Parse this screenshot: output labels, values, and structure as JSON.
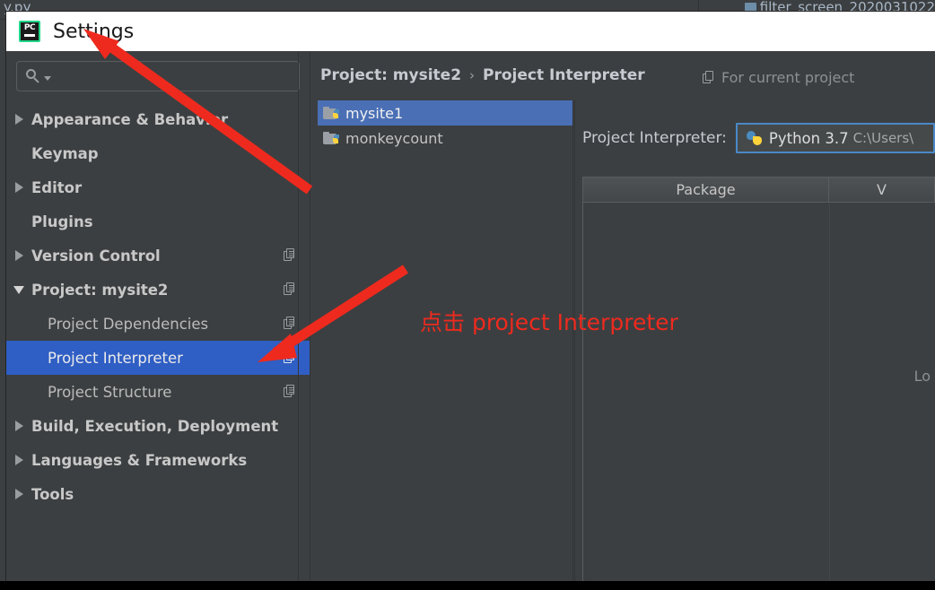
{
  "background": {
    "tab_left": "y.py",
    "tab_right": "filter_screen_2020031022",
    "tab_right_icon": "file-icon"
  },
  "dialog": {
    "title": "Settings",
    "logo_icon": "pycharm-logo-icon",
    "logo_text": "PC"
  },
  "search": {
    "value": "",
    "placeholder": "",
    "icon": "search-icon",
    "caret_icon": "chevron-down-icon"
  },
  "sidebar": {
    "items": [
      {
        "label": "Appearance & Behavior",
        "twisty": "collapsed",
        "indent": 0,
        "bold": true,
        "copy": false,
        "selected": false
      },
      {
        "label": "Keymap",
        "twisty": "none",
        "indent": 0,
        "bold": true,
        "copy": false,
        "selected": false
      },
      {
        "label": "Editor",
        "twisty": "collapsed",
        "indent": 0,
        "bold": true,
        "copy": false,
        "selected": false
      },
      {
        "label": "Plugins",
        "twisty": "none",
        "indent": 0,
        "bold": true,
        "copy": false,
        "selected": false
      },
      {
        "label": "Version Control",
        "twisty": "collapsed",
        "indent": 0,
        "bold": true,
        "copy": true,
        "selected": false
      },
      {
        "label": "Project: mysite2",
        "twisty": "expanded",
        "indent": 0,
        "bold": true,
        "copy": true,
        "selected": false
      },
      {
        "label": "Project Dependencies",
        "twisty": "none",
        "indent": 1,
        "bold": false,
        "copy": true,
        "selected": false
      },
      {
        "label": "Project Interpreter",
        "twisty": "none",
        "indent": 1,
        "bold": false,
        "copy": true,
        "selected": true
      },
      {
        "label": "Project Structure",
        "twisty": "none",
        "indent": 1,
        "bold": false,
        "copy": true,
        "selected": false
      },
      {
        "label": "Build, Execution, Deployment",
        "twisty": "collapsed",
        "indent": 0,
        "bold": true,
        "copy": false,
        "selected": false
      },
      {
        "label": "Languages & Frameworks",
        "twisty": "collapsed",
        "indent": 0,
        "bold": true,
        "copy": false,
        "selected": false
      },
      {
        "label": "Tools",
        "twisty": "collapsed",
        "indent": 0,
        "bold": true,
        "copy": false,
        "selected": false
      }
    ]
  },
  "main": {
    "breadcrumb": {
      "parent": "Project: mysite2",
      "separator": "›",
      "current": "Project Interpreter"
    },
    "for_current_project": {
      "label": "For current project",
      "icon": "copy-icon"
    },
    "projects": [
      {
        "label": "mysite1",
        "icon": "python-folder-icon",
        "selected": true
      },
      {
        "label": "monkeycount",
        "icon": "python-folder-icon",
        "selected": false
      }
    ],
    "interpreter": {
      "label": "Project Interpreter:",
      "icon": "python-icon",
      "name": "Python 3.7",
      "path": "C:\\Users\\"
    },
    "packages_table": {
      "columns": [
        "Package",
        "V"
      ],
      "rows": [],
      "status": "Lo"
    }
  },
  "annotations": {
    "accent_color": "#ee2a1e",
    "text": "点击 project Interpreter",
    "arrows": [
      {
        "name": "arrow-to-settings-title"
      },
      {
        "name": "arrow-to-project-interpreter"
      }
    ]
  }
}
